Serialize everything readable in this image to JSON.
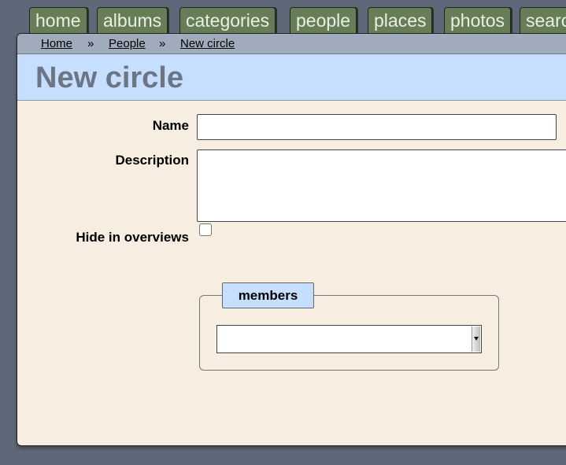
{
  "tabs": [
    {
      "label": "home"
    },
    {
      "label": "albums"
    },
    {
      "label": "categories"
    },
    {
      "label": "people"
    },
    {
      "label": "places"
    },
    {
      "label": "photos"
    },
    {
      "label": "search"
    }
  ],
  "breadcrumb": {
    "items": [
      "Home",
      "People",
      "New circle"
    ],
    "separator": "»"
  },
  "page": {
    "title": "New circle"
  },
  "form": {
    "name_label": "Name",
    "name_value": "",
    "description_label": "Description",
    "description_value": "",
    "hide_label": "Hide in overviews",
    "hide_checked": false,
    "members_legend": "members",
    "members_selected": ""
  },
  "colors": {
    "tab_bg": "#667e58",
    "breadcrumb_bg": "#a0acbc",
    "title_bar_bg": "#c7dfff",
    "panel_bg": "#f7ede1",
    "page_bg": "#5e6878"
  }
}
